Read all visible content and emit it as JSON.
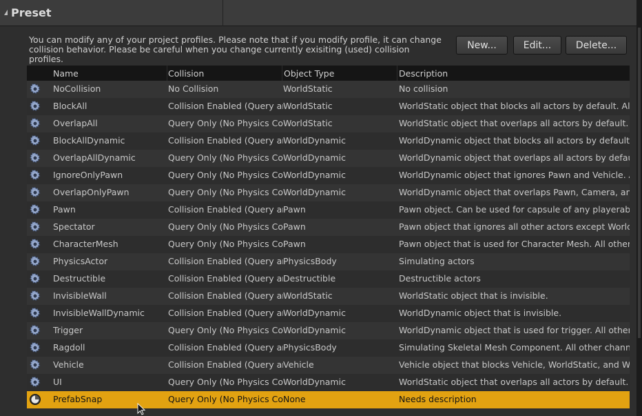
{
  "header": {
    "title": "Preset"
  },
  "note": "You can modify any of your project profiles. Please note that if you modify profile, it can change collision behavior. Please be careful when you change currently exisiting (used) collision profiles.",
  "buttons": {
    "new": "New...",
    "edit": "Edit...",
    "delete": "Delete..."
  },
  "columns": [
    "Name",
    "Collision",
    "Object Type",
    "Description"
  ],
  "icons": {
    "row": "gear-icon",
    "selected": "toggle-knob-icon"
  },
  "colors": {
    "accent": "#e2a211",
    "header": "#3c3c3c",
    "table_header": "#151515"
  },
  "rows": [
    {
      "name": "NoCollision",
      "collision": "No Collision",
      "object_type": "WorldStatic",
      "description": "No collision"
    },
    {
      "name": "BlockAll",
      "collision": "Collision Enabled (Query and P",
      "object_type": "WorldStatic",
      "description": "WorldStatic object that blocks all actors by default. All new"
    },
    {
      "name": "OverlapAll",
      "collision": "Query Only (No Physics Collis",
      "object_type": "WorldStatic",
      "description": "WorldStatic object that overlaps all actors by default. All ne"
    },
    {
      "name": "BlockAllDynamic",
      "collision": "Collision Enabled (Query and P",
      "object_type": "WorldDynamic",
      "description": "WorldDynamic object that blocks all actors by default. All ne"
    },
    {
      "name": "OverlapAllDynamic",
      "collision": "Query Only (No Physics Collis",
      "object_type": "WorldDynamic",
      "description": "WorldDynamic object that overlaps all actors by default. All"
    },
    {
      "name": "IgnoreOnlyPawn",
      "collision": "Query Only (No Physics Collis",
      "object_type": "WorldDynamic",
      "description": "WorldDynamic object that ignores Pawn and Vehicle. All oth"
    },
    {
      "name": "OverlapOnlyPawn",
      "collision": "Query Only (No Physics Collis",
      "object_type": "WorldDynamic",
      "description": "WorldDynamic object that overlaps Pawn, Camera, and Veh"
    },
    {
      "name": "Pawn",
      "collision": "Collision Enabled (Query and P",
      "object_type": "Pawn",
      "description": "Pawn object. Can be used for capsule of any playerable cha"
    },
    {
      "name": "Spectator",
      "collision": "Query Only (No Physics Collis",
      "object_type": "Pawn",
      "description": "Pawn object that ignores all other actors except WorldStati"
    },
    {
      "name": "CharacterMesh",
      "collision": "Query Only (No Physics Collis",
      "object_type": "Pawn",
      "description": "Pawn object that is used for Character Mesh. All other char"
    },
    {
      "name": "PhysicsActor",
      "collision": "Collision Enabled (Query and P",
      "object_type": "PhysicsBody",
      "description": "Simulating actors"
    },
    {
      "name": "Destructible",
      "collision": "Collision Enabled (Query and P",
      "object_type": "Destructible",
      "description": "Destructible actors"
    },
    {
      "name": "InvisibleWall",
      "collision": "Collision Enabled (Query and P",
      "object_type": "WorldStatic",
      "description": "WorldStatic object that is invisible."
    },
    {
      "name": "InvisibleWallDynamic",
      "collision": "Collision Enabled (Query and P",
      "object_type": "WorldDynamic",
      "description": "WorldDynamic object that is invisible."
    },
    {
      "name": "Trigger",
      "collision": "Query Only (No Physics Collis",
      "object_type": "WorldDynamic",
      "description": "WorldDynamic object that is used for trigger. All other chan"
    },
    {
      "name": "Ragdoll",
      "collision": "Collision Enabled (Query and P",
      "object_type": "PhysicsBody",
      "description": "Simulating Skeletal Mesh Component. All other channels wi"
    },
    {
      "name": "Vehicle",
      "collision": "Collision Enabled (Query and P",
      "object_type": "Vehicle",
      "description": "Vehicle object that blocks Vehicle, WorldStatic, and WorldD"
    },
    {
      "name": "UI",
      "collision": "Query Only (No Physics Collis",
      "object_type": "WorldDynamic",
      "description": "WorldStatic object that overlaps all actors by default. All ne"
    },
    {
      "name": "PrefabSnap",
      "collision": "Query Only (No Physics Collis",
      "object_type": "None",
      "description": "Needs description",
      "selected": true
    }
  ]
}
